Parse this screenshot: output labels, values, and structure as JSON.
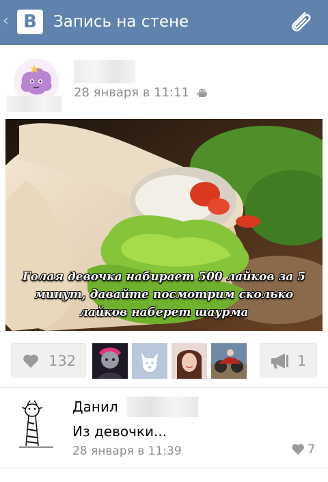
{
  "header": {
    "back_glyph": "‹",
    "logo_letter": "B",
    "title": "Запись на стене",
    "attach_icon": "paperclip-icon",
    "bg_color": "#5f83ad"
  },
  "post": {
    "date": "28 января в 11:11",
    "platform_icon": "android-icon",
    "image_caption": "Голая девочка набирает 500 лайков за 5 минут, давайте посмотрим сколько лайков наберет шаурма",
    "likes": "132",
    "shares": "1",
    "likers_icons": [
      "liker-avatar",
      "vk-dog-avatar",
      "liker-avatar",
      "liker-avatar"
    ]
  },
  "comment": {
    "author": "Данил",
    "text": "Из девочки...",
    "date": "28 января в 11:39",
    "likes": "7"
  }
}
